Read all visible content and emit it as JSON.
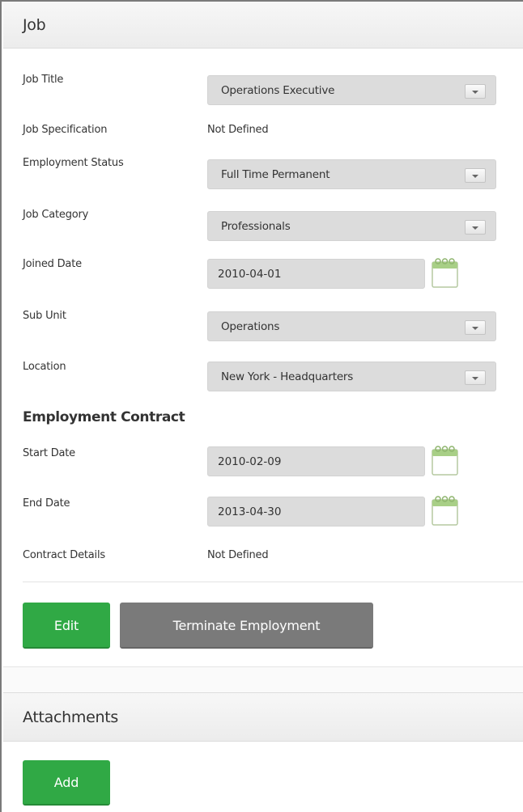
{
  "job_panel": {
    "title": "Job",
    "fields": {
      "job_title": {
        "label": "Job Title",
        "value": "Operations Executive"
      },
      "job_specification": {
        "label": "Job Specification",
        "value": "Not Defined"
      },
      "employment_status": {
        "label": "Employment Status",
        "value": "Full Time Permanent"
      },
      "job_category": {
        "label": "Job Category",
        "value": "Professionals"
      },
      "joined_date": {
        "label": "Joined Date",
        "value": "2010-04-01"
      },
      "sub_unit": {
        "label": "Sub Unit",
        "value": "Operations"
      },
      "location": {
        "label": "Location",
        "value": "New York - Headquarters"
      }
    },
    "contract": {
      "title": "Employment Contract",
      "start_date": {
        "label": "Start Date",
        "value": "2010-02-09"
      },
      "end_date": {
        "label": "End Date",
        "value": "2013-04-30"
      },
      "contract_details": {
        "label": "Contract Details",
        "value": "Not Defined"
      }
    },
    "buttons": {
      "edit": "Edit",
      "terminate": "Terminate Employment"
    }
  },
  "attachments_panel": {
    "title": "Attachments",
    "add_label": "Add"
  },
  "colors": {
    "accent_green": "#30a945",
    "button_gray": "#7a7a7a",
    "field_bg": "#dcdcdc"
  },
  "icons": {
    "dropdown": "chevron-down-icon",
    "calendar": "calendar-icon"
  }
}
